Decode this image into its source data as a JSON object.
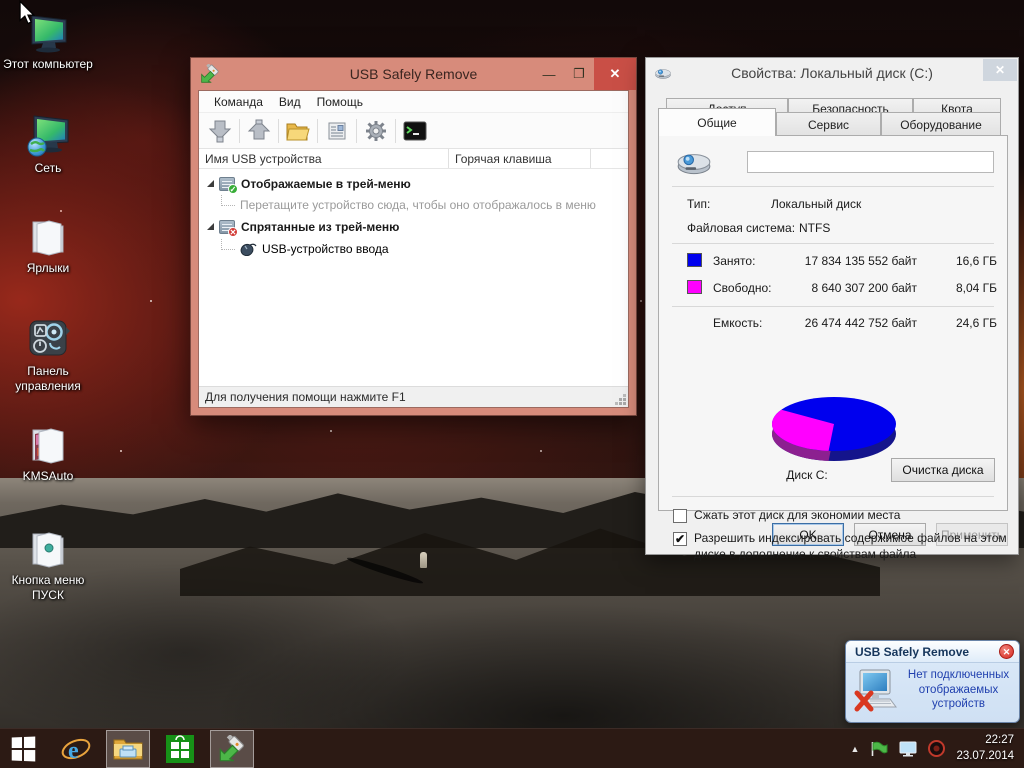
{
  "desktop": {
    "icons": [
      {
        "label": "Этот компьютер"
      },
      {
        "label": "Сеть"
      },
      {
        "label": "Ярлыки"
      },
      {
        "label": "Панель управления"
      },
      {
        "label": "KMSAuto"
      },
      {
        "label": "Кнопка меню ПУСК"
      }
    ]
  },
  "usb_window": {
    "title": "USB Safely Remove",
    "menu": {
      "command": "Команда",
      "view": "Вид",
      "help": "Помощь"
    },
    "columns": {
      "device_name": "Имя USB устройства",
      "hotkey": "Горячая клавиша"
    },
    "tree": {
      "shown_group": "Отображаемые в трей-меню",
      "drag_hint": "Перетащите устройство сюда, чтобы оно отображалось в меню",
      "hidden_group": "Спрятанные из трей-меню",
      "device": "USB-устройство ввода"
    },
    "status": "Для получения помощи нажмите F1"
  },
  "properties_dialog": {
    "title": "Свойства: Локальный диск (C:)",
    "tabs": {
      "access": "Доступ",
      "security": "Безопасность",
      "quota": "Квота",
      "general": "Общие",
      "tools": "Сервис",
      "hardware": "Оборудование"
    },
    "label_input_value": "",
    "type_label": "Тип:",
    "type_value": "Локальный диск",
    "fs_label": "Файловая система:",
    "fs_value": "NTFS",
    "used_label": "Занято:",
    "used_bytes": "17 834 135 552 байт",
    "used_size": "16,6 ГБ",
    "free_label": "Свободно:",
    "free_bytes": "8 640 307 200 байт",
    "free_size": "8,04 ГБ",
    "capacity_label": "Емкость:",
    "capacity_bytes": "26 474 442 752 байт",
    "capacity_size": "24,6 ГБ",
    "disk_caption": "Диск C:",
    "cleanup_button": "Очистка диска",
    "checkbox_compress": {
      "label": "Сжать этот диск для экономии места",
      "mark": ""
    },
    "checkbox_index": {
      "label": "Разрешить индексировать содержимое файлов на этом диске в дополнение к свойствам файла",
      "mark": "✔"
    },
    "ok_button": "OK",
    "cancel_button": "Отмена",
    "apply_button": "Применить"
  },
  "chart_data": {
    "type": "pie",
    "title": "Диск C:",
    "labels": [
      "Занято",
      "Свободно"
    ],
    "values_bytes": [
      17834135552,
      8640307200
    ],
    "values_gb": [
      16.6,
      8.04
    ],
    "percentages": [
      67.4,
      32.6
    ],
    "colors": [
      "#0000ee",
      "#ff00ff"
    ],
    "style": "3d",
    "legend_position": "above-in-table"
  },
  "notification": {
    "title": "USB Safely Remove",
    "message": "Нет подключенных отображаемых устройств"
  },
  "taskbar": {
    "time": "22:27",
    "date": "23.07.2014"
  }
}
